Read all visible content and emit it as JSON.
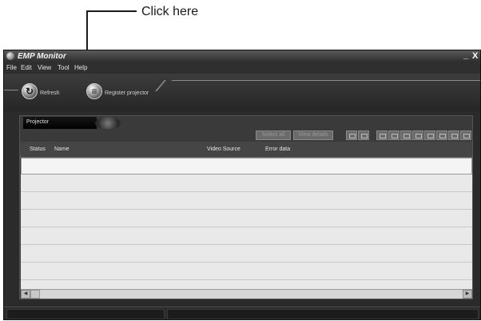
{
  "callout": {
    "text": "Click here"
  },
  "window": {
    "title": "EMP Monitor",
    "minimize": "_",
    "close": "X"
  },
  "menu": [
    "File",
    "Edit",
    "View",
    "Tool",
    "Help"
  ],
  "toolbar": {
    "refresh_label": "Refresh",
    "register_label": "Register projector"
  },
  "panel": {
    "tab_label": "Projector",
    "select_all": "Select all",
    "view_details": "View details"
  },
  "columns": [
    "Status",
    "Name",
    "Video Source",
    "Error data"
  ]
}
